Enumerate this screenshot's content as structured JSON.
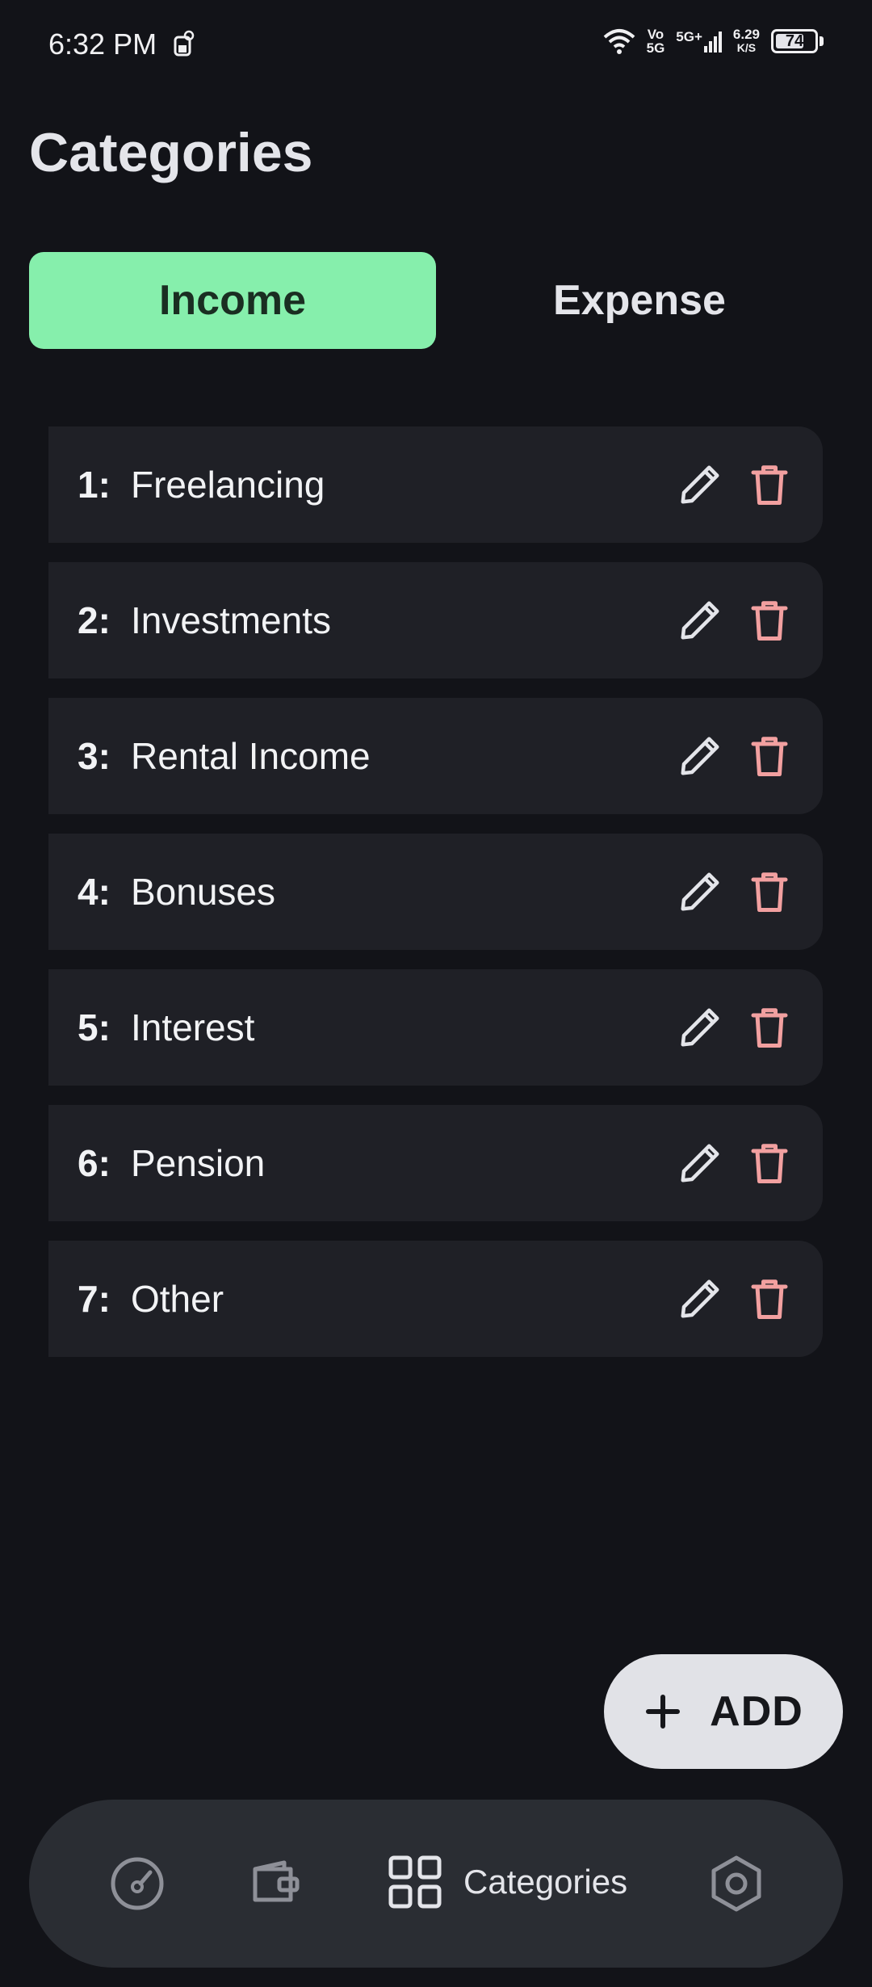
{
  "status_bar": {
    "time": "6:32 PM",
    "volte_top": "Vo",
    "volte_bottom": "5G",
    "network": "5G+",
    "speed_value": "6.29",
    "speed_unit": "K/S",
    "battery": "74",
    "battery_level_percent": 74
  },
  "page": {
    "title": "Categories"
  },
  "tabs": [
    {
      "label": "Income",
      "active": true
    },
    {
      "label": "Expense",
      "active": false
    }
  ],
  "categories": [
    {
      "num": "1:",
      "name": "Freelancing"
    },
    {
      "num": "2:",
      "name": "Investments"
    },
    {
      "num": "3:",
      "name": "Rental Income"
    },
    {
      "num": "4:",
      "name": "Bonuses"
    },
    {
      "num": "5:",
      "name": "Interest"
    },
    {
      "num": "6:",
      "name": "Pension"
    },
    {
      "num": "7:",
      "name": "Other"
    }
  ],
  "icons": {
    "edit": "pencil-icon",
    "delete": "trash-icon",
    "add": "plus-icon",
    "nav": [
      "dashboard-gauge-icon",
      "wallet-icon",
      "categories-grid-icon",
      "settings-hexagon-icon"
    ]
  },
  "fab": {
    "label": "ADD"
  },
  "bottom_nav": {
    "active_label": "Categories"
  },
  "colors": {
    "background": "#121318",
    "accent_green": "#86EFAC",
    "delete_red": "#F2A0A0",
    "card": "#1F2026",
    "nav": "#2A2D33"
  }
}
